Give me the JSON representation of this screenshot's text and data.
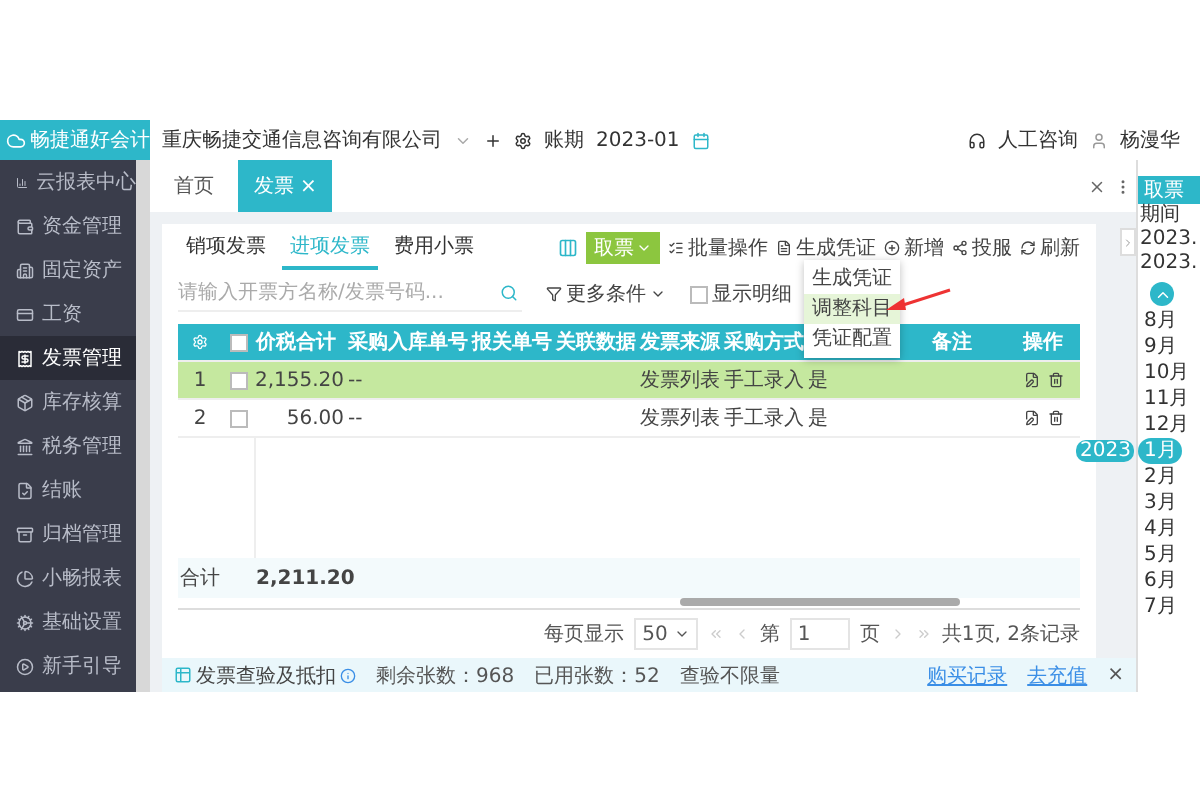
{
  "header": {
    "logo": "畅捷通好会计",
    "company": "重庆畅捷交通信息咨询有限公司",
    "period_label": "账期",
    "period": "2023-01",
    "support": "人工咨询",
    "user": "杨漫华"
  },
  "sidebar": {
    "items": [
      {
        "label": "云报表中心",
        "selected": false
      },
      {
        "label": "资金管理",
        "selected": false
      },
      {
        "label": "固定资产",
        "selected": false
      },
      {
        "label": "工资",
        "selected": false
      },
      {
        "label": "发票管理",
        "selected": true
      },
      {
        "label": "库存核算",
        "selected": false
      },
      {
        "label": "税务管理",
        "selected": false
      },
      {
        "label": "结账",
        "selected": false
      },
      {
        "label": "归档管理",
        "selected": false
      },
      {
        "label": "小畅报表",
        "selected": false
      },
      {
        "label": "基础设置",
        "selected": false
      },
      {
        "label": "新手引导",
        "selected": false
      }
    ]
  },
  "page_tabs": [
    {
      "label": "首页",
      "selected": false
    },
    {
      "label": "发票",
      "selected": true,
      "close": "×"
    }
  ],
  "subtabs": [
    {
      "label": "销项发票",
      "selected": false
    },
    {
      "label": "进项发票",
      "selected": true
    },
    {
      "label": "费用小票",
      "selected": false
    }
  ],
  "search": {
    "placeholder": "请输入开票方名称/发票号码..."
  },
  "filters": {
    "more": "更多条件",
    "show_detail": {
      "label": "显示明细",
      "checked": false
    }
  },
  "toolbar": {
    "primary": "取票",
    "actions": [
      "批量操作",
      "生成凭证",
      "新增",
      "投服",
      "刷新"
    ]
  },
  "menu": {
    "items": [
      {
        "label": "生成凭证",
        "selected": false
      },
      {
        "label": "调整科目",
        "selected": true
      },
      {
        "label": "凭证配置",
        "selected": false
      }
    ]
  },
  "table": {
    "select_all": {
      "checked": false
    },
    "columns": [
      "价税合计",
      "采购入库单号",
      "报关单号",
      "关联数据",
      "发票来源",
      "采购方式",
      "备注"
    ],
    "actions_label": "操作",
    "rows": [
      {
        "index": "1",
        "checked": false,
        "selected": true,
        "amount": "2,155.20",
        "inbound_no": "--",
        "source": "发票列表",
        "method": "手工录入",
        "column_9": "是"
      },
      {
        "index": "2",
        "checked": false,
        "selected": false,
        "amount": "56.00",
        "inbound_no": "--",
        "source": "发票列表",
        "method": "手工录入",
        "column_9": "是"
      }
    ],
    "total": {
      "label": "合计",
      "value": "2,211.20"
    }
  },
  "pagination": {
    "per_page_label": "每页显示",
    "per_page": "50",
    "page_prefix": "第",
    "page": "1",
    "page_suffix": "页",
    "summary": "共1页, 2条记录"
  },
  "quota_bar": {
    "title": "发票查验及抵扣",
    "remaining": "剩余张数：968",
    "used": "已用张数：52",
    "unlimited": "查验不限量",
    "links": [
      "购买记录",
      "去充值"
    ],
    "close": "×"
  },
  "period_panel": {
    "button": "取票",
    "label": "期间",
    "dates": [
      "2023.",
      "2023."
    ],
    "badge": "2023",
    "months": [
      {
        "label": "8月",
        "selected": false
      },
      {
        "label": "9月",
        "selected": false
      },
      {
        "label": "10月",
        "selected": false
      },
      {
        "label": "11月",
        "selected": false
      },
      {
        "label": "12月",
        "selected": false
      },
      {
        "label": "1月",
        "selected": true
      },
      {
        "label": "2月",
        "selected": false
      },
      {
        "label": "3月",
        "selected": false
      },
      {
        "label": "4月",
        "selected": false
      },
      {
        "label": "5月",
        "selected": false
      },
      {
        "label": "6月",
        "selected": false
      },
      {
        "label": "7月",
        "selected": false
      }
    ]
  }
}
